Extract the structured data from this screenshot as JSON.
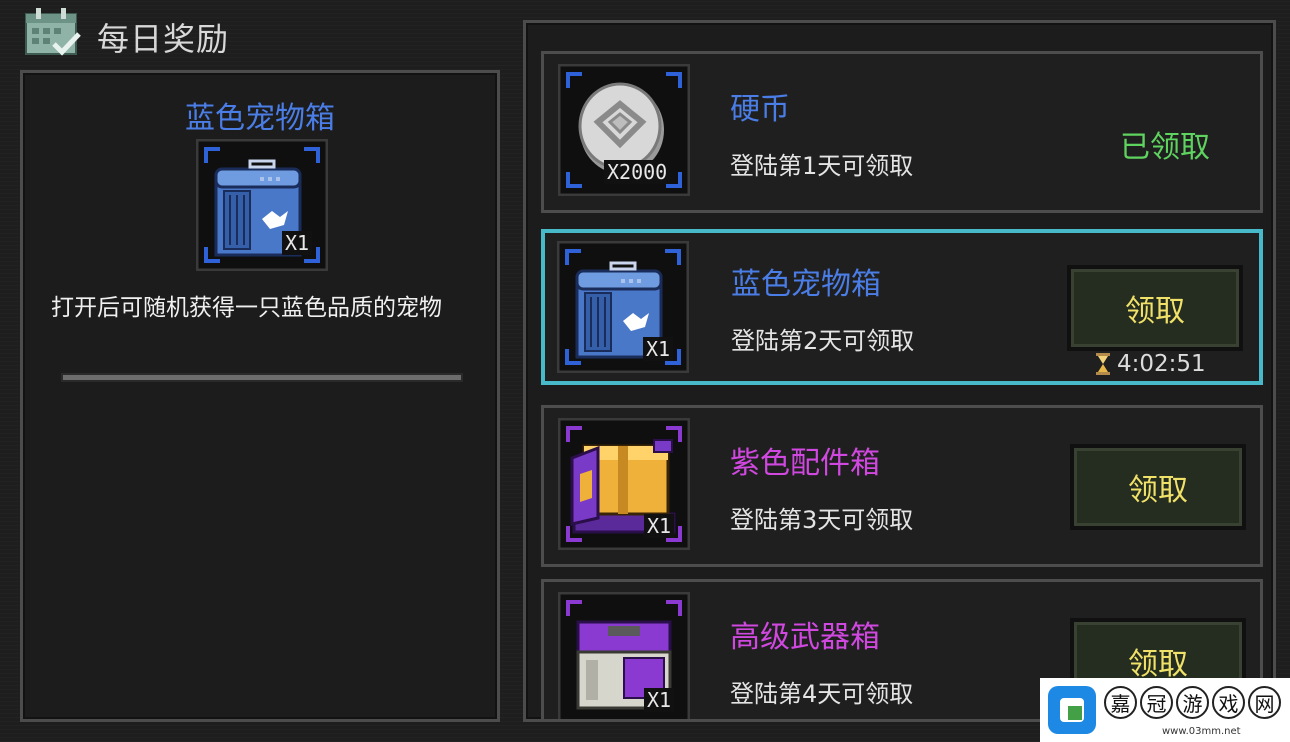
{
  "header": {
    "title": "每日奖励",
    "icon": "calendar-check-icon"
  },
  "detail": {
    "title": "蓝色宠物箱",
    "icon": "blue-pet-crate-icon",
    "quantity": "X1",
    "description": "打开后可随机获得一只蓝色品质的宠物"
  },
  "rewards": [
    {
      "name": "硬币",
      "subtitle": "登陆第1天可领取",
      "quantity": "X2000",
      "icon": "silver-coin-icon",
      "status": "已领取",
      "name_color": "#4a7de6"
    },
    {
      "name": "蓝色宠物箱",
      "subtitle": "登陆第2天可领取",
      "quantity": "X1",
      "icon": "blue-pet-crate-icon",
      "button": "领取",
      "timer": "4:02:51",
      "name_color": "#4a7de6"
    },
    {
      "name": "紫色配件箱",
      "subtitle": "登陆第3天可领取",
      "quantity": "X1",
      "icon": "purple-parts-crate-icon",
      "button": "领取",
      "name_color": "#d048e0"
    },
    {
      "name": "高级武器箱",
      "subtitle": "登陆第4天可领取",
      "quantity": "X1",
      "icon": "advanced-weapon-crate-icon",
      "button": "领取",
      "name_color": "#d048e0"
    }
  ],
  "watermark": {
    "chars": [
      "嘉",
      "冠",
      "游",
      "戏",
      "网"
    ],
    "url": "www.03mm.net"
  },
  "colors": {
    "selected_border": "#47b9c8",
    "claimed": "#5fd35f",
    "button_text": "#f0e168"
  }
}
